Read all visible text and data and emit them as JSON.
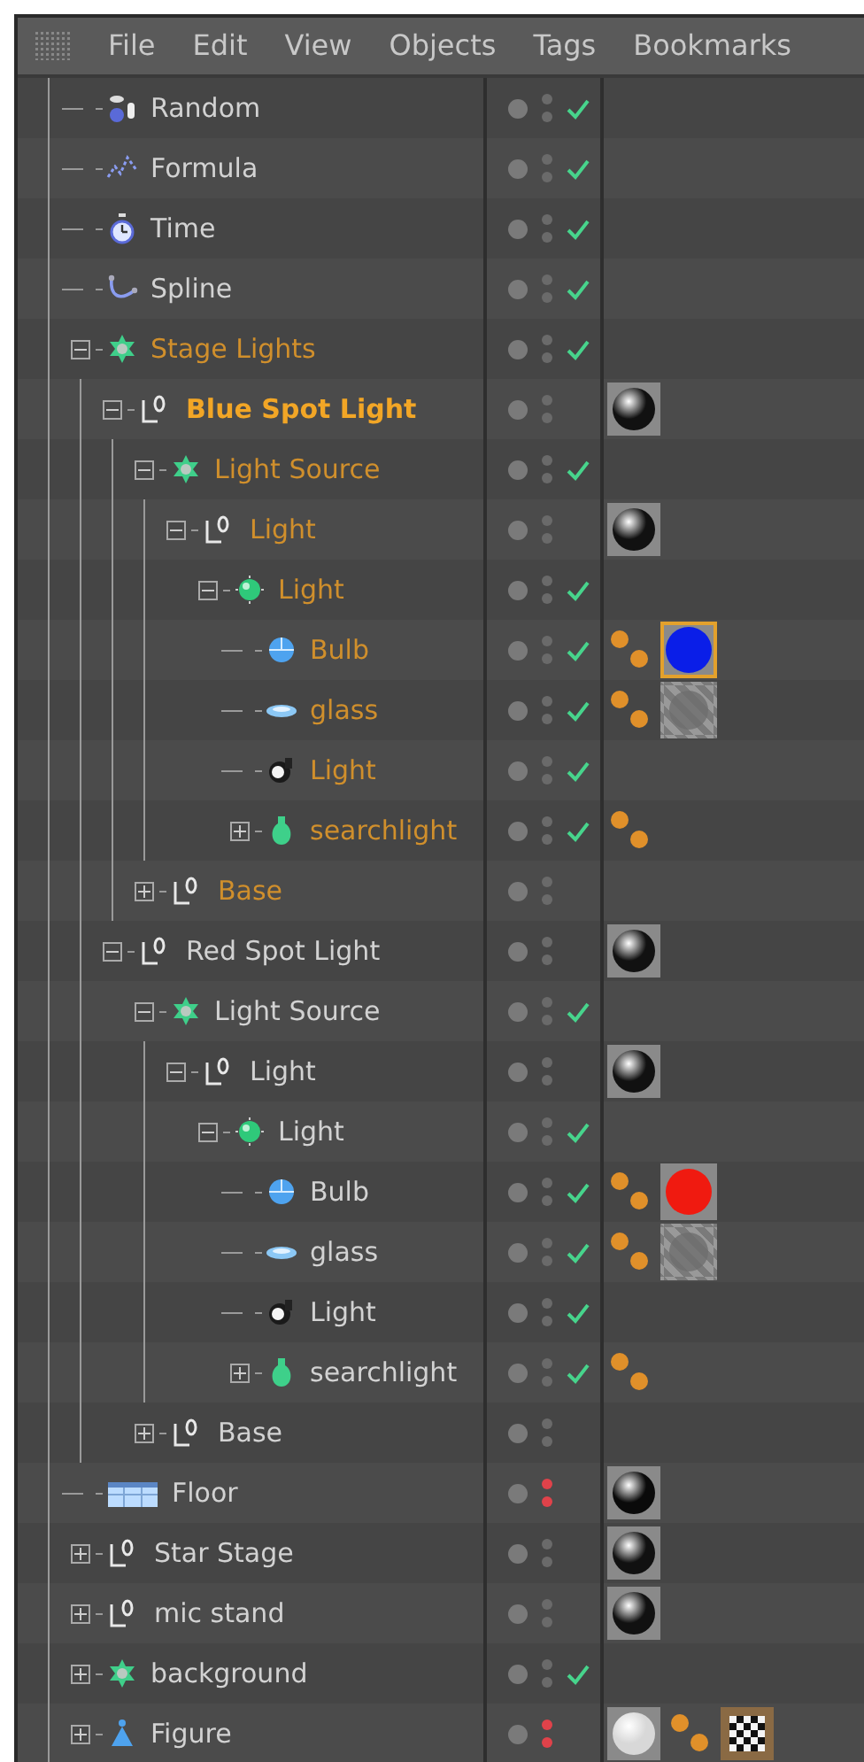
{
  "menu": {
    "items": [
      "File",
      "Edit",
      "View",
      "Objects",
      "Tags",
      "Bookmarks"
    ]
  },
  "objects": [
    {
      "name": "Random",
      "kind": "random",
      "selected": false,
      "active": false,
      "red_dots": false,
      "enabled": true
    },
    {
      "name": "Formula",
      "kind": "formula",
      "selected": false,
      "active": false,
      "red_dots": false,
      "enabled": true
    },
    {
      "name": "Time",
      "kind": "time",
      "selected": false,
      "active": false,
      "red_dots": false,
      "enabled": true
    },
    {
      "name": "Spline",
      "kind": "spline",
      "selected": false,
      "active": false,
      "red_dots": false,
      "enabled": true
    },
    {
      "name": "Stage Lights",
      "kind": "cloner",
      "selected": true,
      "active": false,
      "red_dots": false,
      "enabled": true,
      "expanded": true,
      "children": [
        {
          "name": "Blue Spot Light",
          "kind": "null",
          "selected": true,
          "active": true,
          "red_dots": false,
          "enabled": false,
          "tags": [
            {
              "kind": "sphere",
              "color": "#111111",
              "selected": false
            }
          ],
          "expanded": true,
          "children": [
            {
              "name": "Light Source",
              "kind": "cloner",
              "selected": true,
              "active": false,
              "red_dots": false,
              "enabled": true,
              "expanded": true,
              "children": [
                {
                  "name": "Light",
                  "kind": "null",
                  "selected": true,
                  "active": false,
                  "red_dots": false,
                  "enabled": false,
                  "tags": [
                    {
                      "kind": "sphere",
                      "color": "#111111",
                      "selected": false
                    }
                  ],
                  "expanded": true,
                  "children": [
                    {
                      "name": "Light",
                      "kind": "ball",
                      "selected": true,
                      "active": false,
                      "red_dots": false,
                      "enabled": true,
                      "expanded": true,
                      "children": [
                        {
                          "name": "Bulb",
                          "kind": "bulb",
                          "selected": true,
                          "active": false,
                          "red_dots": false,
                          "enabled": true,
                          "tags": [
                            {
                              "kind": "phong",
                              "selected": false
                            },
                            {
                              "kind": "swatch",
                              "color": "#0a1ee8",
                              "selected": true
                            }
                          ]
                        },
                        {
                          "name": "glass",
                          "kind": "disc",
                          "selected": true,
                          "active": false,
                          "red_dots": false,
                          "enabled": true,
                          "tags": [
                            {
                              "kind": "phong",
                              "selected": false
                            },
                            {
                              "kind": "glass",
                              "selected": false
                            }
                          ]
                        },
                        {
                          "name": "Light",
                          "kind": "lamp",
                          "selected": true,
                          "active": false,
                          "red_dots": false,
                          "enabled": true
                        },
                        {
                          "name": "searchlight",
                          "kind": "vase",
                          "selected": true,
                          "active": false,
                          "red_dots": false,
                          "enabled": true,
                          "tags": [
                            {
                              "kind": "phong",
                              "selected": false
                            }
                          ],
                          "expanded": false
                        }
                      ]
                    }
                  ]
                }
              ]
            },
            {
              "name": "Base",
              "kind": "null",
              "selected": true,
              "active": false,
              "red_dots": false,
              "enabled": false,
              "expanded": false
            }
          ]
        },
        {
          "name": "Red Spot Light",
          "kind": "null",
          "selected": false,
          "active": false,
          "red_dots": false,
          "enabled": false,
          "tags": [
            {
              "kind": "sphere",
              "color": "#111111",
              "selected": false
            }
          ],
          "expanded": true,
          "children": [
            {
              "name": "Light Source",
              "kind": "cloner",
              "selected": false,
              "active": false,
              "red_dots": false,
              "enabled": true,
              "expanded": true,
              "children": [
                {
                  "name": "Light",
                  "kind": "null",
                  "selected": false,
                  "active": false,
                  "red_dots": false,
                  "enabled": false,
                  "tags": [
                    {
                      "kind": "sphere",
                      "color": "#111111",
                      "selected": false
                    }
                  ],
                  "expanded": true,
                  "children": [
                    {
                      "name": "Light",
                      "kind": "ball",
                      "selected": false,
                      "active": false,
                      "red_dots": false,
                      "enabled": true,
                      "expanded": true,
                      "children": [
                        {
                          "name": "Bulb",
                          "kind": "bulb",
                          "selected": false,
                          "active": false,
                          "red_dots": false,
                          "enabled": true,
                          "tags": [
                            {
                              "kind": "phong",
                              "selected": false
                            },
                            {
                              "kind": "swatch",
                              "color": "#f01a10",
                              "selected": false
                            }
                          ]
                        },
                        {
                          "name": "glass",
                          "kind": "disc",
                          "selected": false,
                          "active": false,
                          "red_dots": false,
                          "enabled": true,
                          "tags": [
                            {
                              "kind": "phong",
                              "selected": false
                            },
                            {
                              "kind": "glass",
                              "selected": false
                            }
                          ]
                        },
                        {
                          "name": "Light",
                          "kind": "lamp",
                          "selected": false,
                          "active": false,
                          "red_dots": false,
                          "enabled": true
                        },
                        {
                          "name": "searchlight",
                          "kind": "vase",
                          "selected": false,
                          "active": false,
                          "red_dots": false,
                          "enabled": true,
                          "tags": [
                            {
                              "kind": "phong",
                              "selected": false
                            }
                          ],
                          "expanded": false
                        }
                      ]
                    }
                  ]
                }
              ]
            },
            {
              "name": "Base",
              "kind": "null",
              "selected": false,
              "active": false,
              "red_dots": false,
              "enabled": false,
              "expanded": false
            }
          ]
        }
      ]
    },
    {
      "name": "Floor",
      "kind": "floor",
      "selected": false,
      "active": false,
      "red_dots": true,
      "enabled": false,
      "tags": [
        {
          "kind": "sphere",
          "color": "#0a0a0a",
          "selected": false
        }
      ]
    },
    {
      "name": "Star Stage",
      "kind": "null",
      "selected": false,
      "active": false,
      "red_dots": false,
      "enabled": false,
      "tags": [
        {
          "kind": "sphere",
          "color": "#111111",
          "selected": false
        }
      ],
      "expanded": false
    },
    {
      "name": "mic stand",
      "kind": "null",
      "selected": false,
      "active": false,
      "red_dots": false,
      "enabled": false,
      "tags": [
        {
          "kind": "sphere",
          "color": "#111111",
          "selected": false
        }
      ],
      "expanded": false
    },
    {
      "name": "background",
      "kind": "cloner",
      "selected": false,
      "active": false,
      "red_dots": false,
      "enabled": true,
      "expanded": false
    },
    {
      "name": "Figure",
      "kind": "figure",
      "selected": false,
      "active": false,
      "red_dots": true,
      "enabled": false,
      "tags": [
        {
          "kind": "sphere",
          "color": "#d8d8d8",
          "selected": false
        },
        {
          "kind": "phong",
          "selected": false
        },
        {
          "kind": "checker"
        }
      ],
      "expanded": false
    }
  ]
}
